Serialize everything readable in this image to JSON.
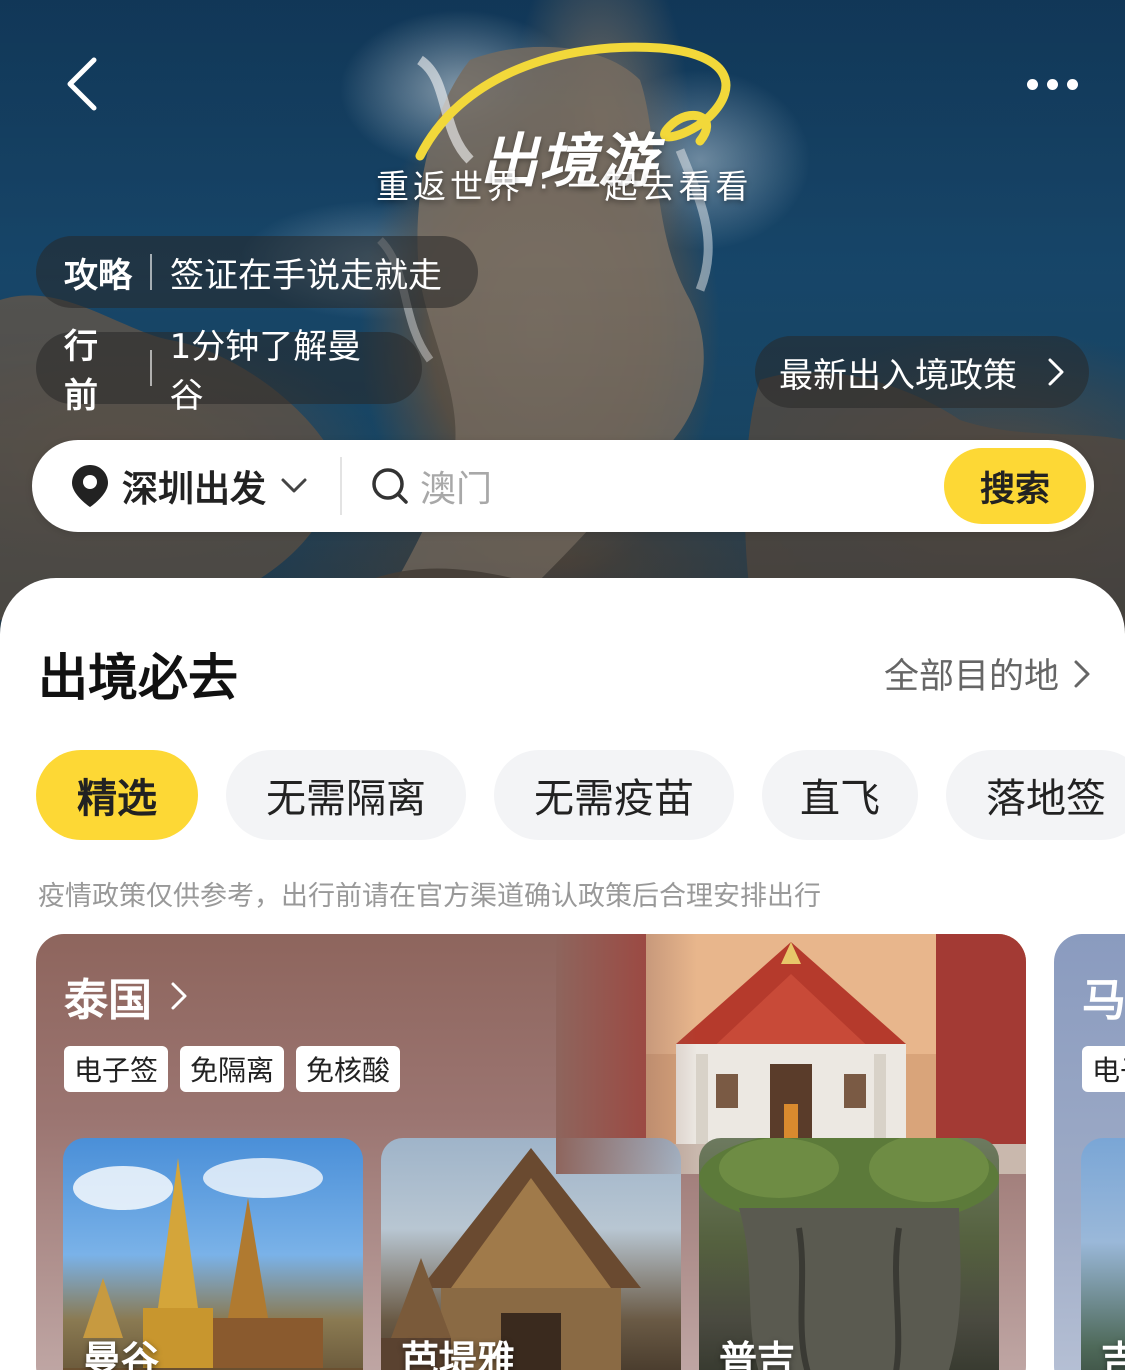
{
  "header": {
    "title": "出境游",
    "subtitle": "重返世界 · 一起去看看"
  },
  "pills": {
    "guide": {
      "tag": "攻略",
      "text": "签证在手说走就走"
    },
    "before": {
      "tag": "行前",
      "text": "1分钟了解曼谷"
    },
    "policy": {
      "text": "最新出入境政策"
    }
  },
  "search": {
    "departure": "深圳出发",
    "placeholder": "澳门",
    "button": "搜索"
  },
  "section": {
    "title": "出境必去",
    "see_all": "全部目的地"
  },
  "filters": [
    {
      "label": "精选",
      "active": true
    },
    {
      "label": "无需隔离",
      "active": false
    },
    {
      "label": "无需疫苗",
      "active": false
    },
    {
      "label": "直飞",
      "active": false
    },
    {
      "label": "落地签",
      "active": false
    }
  ],
  "notice": "疫情政策仅供参考，出行前请在官方渠道确认政策后合理安排出行",
  "countries": [
    {
      "name": "泰国",
      "badges": [
        "电子签",
        "免隔离",
        "免核酸"
      ],
      "cities": [
        "曼谷",
        "芭堤雅",
        "普吉"
      ]
    },
    {
      "name": "马",
      "badges": [
        "电子"
      ],
      "cities": [
        "吉"
      ]
    }
  ],
  "colors": {
    "accent": "#fdd835",
    "thailand_card": "#8e655d",
    "malaysia_card": "#8a9bbf"
  },
  "icons": {
    "back": "chevron-left-icon",
    "more": "more-dots-icon",
    "location": "location-pin-icon",
    "dropdown": "chevron-down-icon",
    "search": "search-icon",
    "arrow": "chevron-right-icon"
  }
}
